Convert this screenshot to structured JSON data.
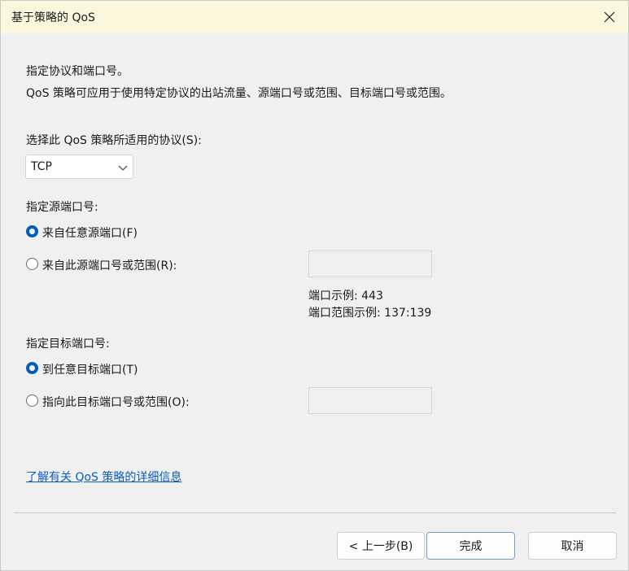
{
  "window": {
    "title": "基于策略的 QoS",
    "close_icon": "close-icon"
  },
  "intro": {
    "heading": "指定协议和端口号。",
    "description": "QoS 策略可应用于使用特定协议的出站流量、源端口号或范围、目标端口号或范围。"
  },
  "protocol": {
    "label": "选择此 QoS 策略所适用的协议(S):",
    "selected": "TCP"
  },
  "source": {
    "label": "指定源端口号:",
    "option_any": "来自任意源端口(F)",
    "option_specific": "来自此源端口号或范围(R):",
    "selected": "any",
    "input_value": "",
    "example_port": "端口示例: 443",
    "example_range": "端口范围示例: 137:139"
  },
  "destination": {
    "label": "指定目标端口号:",
    "option_any": "到任意目标端口(T)",
    "option_specific": "指向此目标端口号或范围(O):",
    "selected": "any",
    "input_value": ""
  },
  "learn_more": "了解有关 QoS 策略的详细信息",
  "buttons": {
    "back": "< 上一步(B)",
    "finish": "完成",
    "cancel": "取消"
  },
  "colors": {
    "titlebar": "#fbf7dc",
    "accent": "#005fb8",
    "link": "#0a5ec0"
  }
}
